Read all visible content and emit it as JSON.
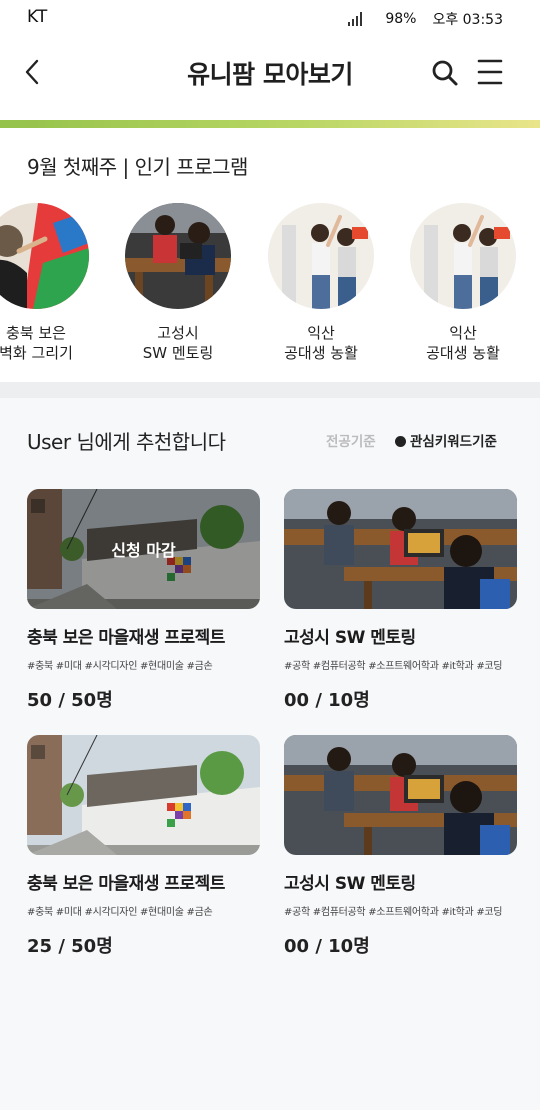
{
  "status_bar": {
    "carrier": "KT",
    "battery": "98%",
    "time": "오후 03:53"
  },
  "header": {
    "title": "유니팜 모아보기",
    "icons": [
      "back-arrow-icon",
      "search-icon",
      "hamburger-menu-icon"
    ]
  },
  "colors": {
    "accent_start": "#94c24a",
    "accent_end": "#e9e58b",
    "filter_inactive": "#bcbcbc",
    "divider": "#eceef0"
  },
  "popular": {
    "title": "9월 첫째주 | 인기 프로그램",
    "programs": [
      {
        "label": "충북 보은\n벽화 그리기"
      },
      {
        "label": "고성시\nSW 멘토링"
      },
      {
        "label": "익산\n공대생 농활"
      },
      {
        "label": "익산\n공대생 농활"
      }
    ]
  },
  "recommend": {
    "title": "User 님에게 추천합니다",
    "filter_major": "전공기준",
    "filter_keyword": "관심키워드기준",
    "cards": [
      {
        "title": "충북 보은 마을재생 프로젝트",
        "tags": "#충북 #미대 #시각디자인 #현대미술 #금손",
        "count": "50 / 50명",
        "overlay": "신청 마감"
      },
      {
        "title": "고성시 SW 멘토링",
        "tags": "#공학 #컴퓨터공학 #소프트웨어학과 #it학과 #코딩",
        "count": "00 / 10명"
      },
      {
        "title": "충북 보은 마을재생 프로젝트",
        "tags": "#충북 #미대 #시각디자인 #현대미술 #금손",
        "count": "25 / 50명"
      },
      {
        "title": "고성시 SW 멘토링",
        "tags": "#공학 #컴퓨터공학 #소프트웨어학과 #it학과 #코딩",
        "count": "00 / 10명"
      }
    ]
  }
}
